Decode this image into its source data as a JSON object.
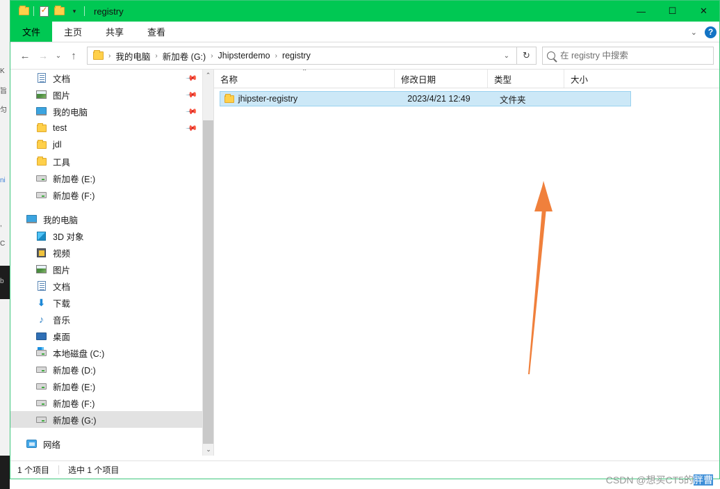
{
  "window": {
    "title": "registry",
    "quick_access": [
      {
        "name": "save-icon",
        "glyph": "folder"
      },
      {
        "name": "properties-icon",
        "glyph": "doc-check"
      },
      {
        "name": "new-folder-icon",
        "glyph": "folder"
      },
      {
        "name": "customize-caret-icon",
        "glyph": "▾"
      }
    ],
    "controls": {
      "minimize": "—",
      "maximize": "☐",
      "close": "✕"
    },
    "accent_color": "#00c853"
  },
  "ribbon": {
    "tabs": [
      {
        "label": "文件",
        "active": true
      },
      {
        "label": "主页",
        "active": false
      },
      {
        "label": "共享",
        "active": false
      },
      {
        "label": "查看",
        "active": false
      }
    ],
    "collapse_caret": "⌄",
    "help_glyph": "?"
  },
  "navbar": {
    "back": "←",
    "forward": "→",
    "recent_caret": "⌄",
    "up": "↑",
    "breadcrumbs": [
      {
        "label": "我的电脑"
      },
      {
        "label": "新加卷 (G:)"
      },
      {
        "label": "Jhipsterdemo"
      },
      {
        "label": "registry"
      }
    ],
    "crumb_separator": "›",
    "path_caret": "⌄",
    "refresh_glyph": "↻"
  },
  "search": {
    "placeholder": "在 registry 中搜索",
    "value": ""
  },
  "sidebar": {
    "quick_items": [
      {
        "label": "文档",
        "icon": "document-icon",
        "pinned": true,
        "indent": 1
      },
      {
        "label": "图片",
        "icon": "picture-icon",
        "pinned": true,
        "indent": 1
      },
      {
        "label": "我的电脑",
        "icon": "computer-icon",
        "pinned": true,
        "indent": 1
      },
      {
        "label": "test",
        "icon": "folder-icon",
        "pinned": true,
        "indent": 1
      },
      {
        "label": "jdl",
        "icon": "folder-icon",
        "pinned": false,
        "indent": 1
      },
      {
        "label": "工具",
        "icon": "folder-icon",
        "pinned": false,
        "indent": 1
      },
      {
        "label": "新加卷 (E:)",
        "icon": "drive-icon",
        "pinned": false,
        "indent": 1
      },
      {
        "label": "新加卷 (F:)",
        "icon": "drive-icon",
        "pinned": false,
        "indent": 1
      }
    ],
    "computer_root": {
      "label": "我的电脑",
      "icon": "computer-icon"
    },
    "computer_items": [
      {
        "label": "3D 对象",
        "icon": "3d-objects-icon"
      },
      {
        "label": "视频",
        "icon": "video-icon"
      },
      {
        "label": "图片",
        "icon": "picture-icon"
      },
      {
        "label": "文档",
        "icon": "document-icon"
      },
      {
        "label": "下载",
        "icon": "download-icon"
      },
      {
        "label": "音乐",
        "icon": "music-icon"
      },
      {
        "label": "桌面",
        "icon": "desktop-icon"
      },
      {
        "label": "本地磁盘 (C:)",
        "icon": "system-drive-icon"
      },
      {
        "label": "新加卷 (D:)",
        "icon": "drive-icon"
      },
      {
        "label": "新加卷 (E:)",
        "icon": "drive-icon"
      },
      {
        "label": "新加卷 (F:)",
        "icon": "drive-icon"
      },
      {
        "label": "新加卷 (G:)",
        "icon": "drive-icon",
        "selected": true
      }
    ],
    "network": {
      "label": "网络",
      "icon": "network-icon"
    },
    "scroll_up": "⌃",
    "scroll_down": "⌄"
  },
  "filelist": {
    "columns": [
      {
        "label": "名称",
        "sorted": "asc"
      },
      {
        "label": "修改日期",
        "sorted": ""
      },
      {
        "label": "类型",
        "sorted": ""
      },
      {
        "label": "大小",
        "sorted": ""
      }
    ],
    "sort_caret": "⌃",
    "rows": [
      {
        "name": "jhipster-registry",
        "date": "2023/4/21 12:49",
        "type": "文件夹",
        "size": "",
        "icon": "folder-icon",
        "selected": true
      }
    ]
  },
  "annotation": {
    "arrow_color": "#f0803c",
    "name": "orange-up-arrow"
  },
  "statusbar": {
    "item_count": "1 个项目",
    "selected_count": "选中 1 个项目"
  },
  "watermark": {
    "prefix": "CSDN @想买CT5的",
    "highlight": "胖曹"
  },
  "background_bleed": {
    "fragments": [
      "K",
      "旨",
      "匀",
      "ni",
      ",",
      "C",
      "b"
    ]
  }
}
